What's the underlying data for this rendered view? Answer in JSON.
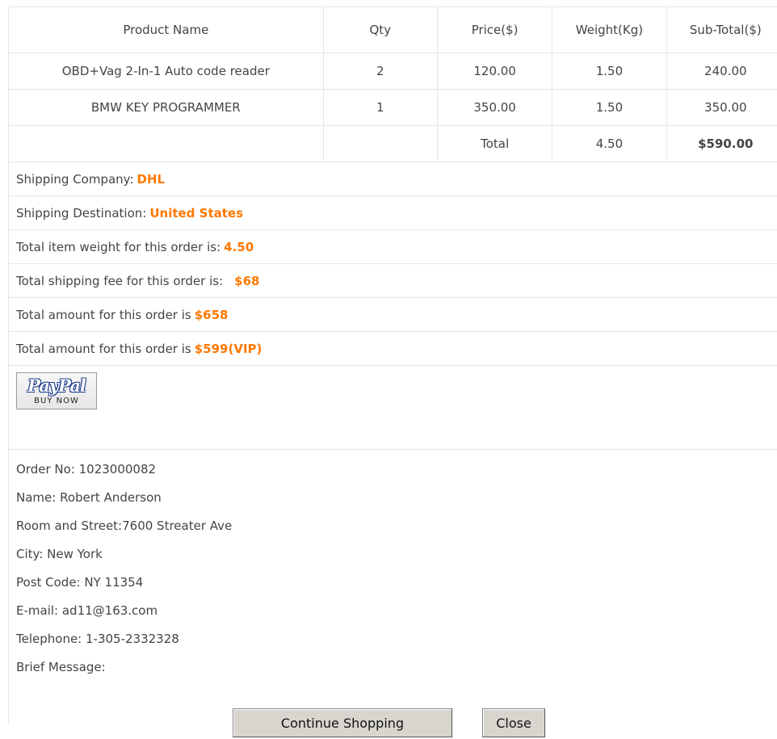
{
  "table": {
    "headers": [
      "Product Name",
      "Qty",
      "Price($)",
      "Weight(Kg)",
      "Sub-Total($)"
    ],
    "rows": [
      {
        "name": "OBD+Vag 2-In-1 Auto code reader",
        "qty": "2",
        "price": "120.00",
        "weight": "1.50",
        "subtotal": "240.00"
      },
      {
        "name": "BMW KEY PROGRAMMER",
        "qty": "1",
        "price": "350.00",
        "weight": "1.50",
        "subtotal": "350.00"
      }
    ],
    "total_label": "Total",
    "total_weight": "4.50",
    "total_amount": "$590.00"
  },
  "info": {
    "shipping_company_label": "Shipping Company:",
    "shipping_company": "DHL",
    "destination_label": "Shipping Destination:",
    "destination": "United States",
    "weight_label": "Total item weight for this order is:",
    "weight": "4.50",
    "fee_label": "Total shipping fee for this order is:",
    "fee": "$68",
    "amount_label": "Total amount for this order is",
    "amount": "$658",
    "vip_label": "Total amount for this order is",
    "vip_amount": "$599(VIP)"
  },
  "paypal": {
    "logo": "PayPal",
    "sub": "BUY NOW"
  },
  "customer": {
    "order_no": "Order No: 1023000082",
    "name": "Name: Robert Anderson",
    "street": "Room and Street:7600 Streater Ave",
    "city": "City: New York",
    "post_code": "Post Code: NY 11354",
    "email": "E-mail: ad11@163.com",
    "telephone": "Telephone: 1-305-2332328",
    "message": "Brief Message:"
  },
  "buttons": {
    "continue": "Continue Shopping",
    "close": "Close"
  },
  "colors": {
    "accent": "#ff7800",
    "border": "#dfe8ee",
    "text": "#444444"
  }
}
